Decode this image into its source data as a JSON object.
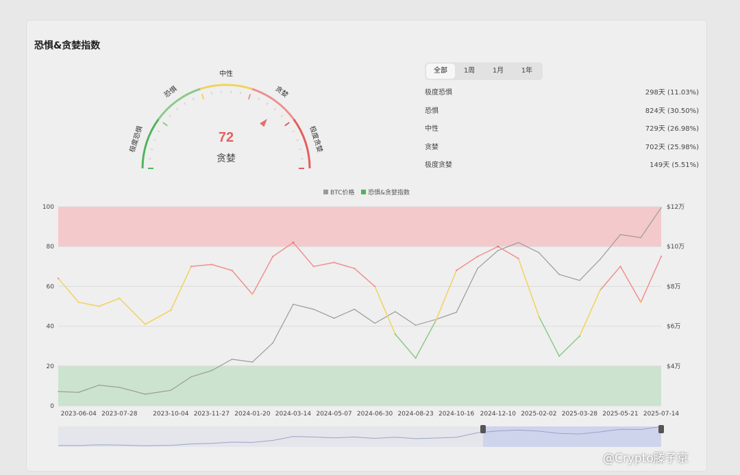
{
  "title": "恐惧&贪婪指数",
  "gauge": {
    "value": 72,
    "state": "贪婪",
    "labels": [
      "极度恐惧",
      "恐惧",
      "中性",
      "贪婪",
      "极度贪婪"
    ]
  },
  "tabs": [
    {
      "label": "全部",
      "active": true
    },
    {
      "label": "1周",
      "active": false
    },
    {
      "label": "1月",
      "active": false
    },
    {
      "label": "1年",
      "active": false
    }
  ],
  "stats": [
    {
      "label": "极度恐惧",
      "value": "298天 (11.03%)"
    },
    {
      "label": "恐惧",
      "value": "824天 (30.50%)"
    },
    {
      "label": "中性",
      "value": "729天 (26.98%)"
    },
    {
      "label": "贪婪",
      "value": "702天 (25.98%)"
    },
    {
      "label": "极度贪婪",
      "value": "149天 (5.51%)"
    }
  ],
  "watermark": "@Crypto滕子京",
  "colors": {
    "extreme_fear": "#52b35a",
    "fear": "#8cc98a",
    "neutral": "#f0d35a",
    "greed": "#f08f8f",
    "extreme_greed": "#e65b5b",
    "btc_line": "#9a9a9a",
    "greed_band": "#f3c9cc",
    "fear_band": "#cce3cf"
  },
  "chart_data": {
    "type": "line",
    "legend": [
      "BTC价格",
      "恐惧&贪婪指数"
    ],
    "legend_position": "top-center",
    "grid": true,
    "ylim_left": [
      0,
      100
    ],
    "ylim_right": [
      20000,
      120000
    ],
    "yticks_left": [
      "0",
      "20",
      "40",
      "60",
      "80",
      "100"
    ],
    "yticks_right": [
      "$4万",
      "$6万",
      "$8万",
      "$10万",
      "$12万"
    ],
    "x_ticks": [
      "2023-06-04",
      "2023-07-28",
      "2023-10-04",
      "2023-11-27",
      "2024-01-20",
      "2024-03-14",
      "2024-05-07",
      "2024-06-30",
      "2024-08-23",
      "2024-10-16",
      "2024-12-10",
      "2025-02-02",
      "2025-03-28",
      "2025-05-21",
      "2025-07-14"
    ],
    "bands": [
      {
        "from": 80,
        "to": 100,
        "name": "extreme_greed"
      },
      {
        "from": 0,
        "to": 20,
        "name": "extreme_fear"
      }
    ],
    "dates": [
      "2023-05-08",
      "2023-06-04",
      "2023-07-01",
      "2023-07-28",
      "2023-08-31",
      "2023-10-04",
      "2023-10-31",
      "2023-11-27",
      "2023-12-24",
      "2024-01-20",
      "2024-02-16",
      "2024-03-14",
      "2024-04-10",
      "2024-05-07",
      "2024-06-03",
      "2024-06-30",
      "2024-07-27",
      "2024-08-23",
      "2024-09-19",
      "2024-10-16",
      "2024-11-13",
      "2024-12-10",
      "2025-01-06",
      "2025-02-02",
      "2025-03-01",
      "2025-03-28",
      "2025-04-24",
      "2025-05-21",
      "2025-06-17",
      "2025-07-14"
    ],
    "series": [
      {
        "name": "恐惧&贪婪指数",
        "axis": "left",
        "values": [
          64,
          52,
          50,
          54,
          41,
          48,
          70,
          71,
          68,
          56,
          75,
          82,
          70,
          72,
          69,
          60,
          36,
          24,
          43,
          68,
          75,
          80,
          74,
          45,
          25,
          35,
          58,
          70,
          52,
          75
        ]
      },
      {
        "name": "BTC价格",
        "axis": "right",
        "values": [
          27200,
          26800,
          30400,
          29300,
          25900,
          27800,
          34600,
          37700,
          43400,
          42000,
          51600,
          71000,
          68500,
          64000,
          68500,
          61500,
          67300,
          60500,
          63400,
          67000,
          89000,
          98000,
          102000,
          97000,
          86000,
          83000,
          93500,
          106000,
          104500,
          119500
        ]
      }
    ]
  }
}
